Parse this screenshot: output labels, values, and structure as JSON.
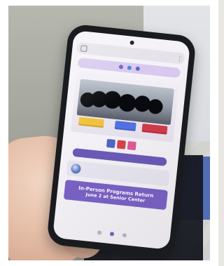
{
  "scene": {
    "device": "smartphone",
    "background_colors": {
      "wall": "#a7a89f",
      "floor_blue": "#4a67b2",
      "jacket": "#1a1d25"
    }
  },
  "phone_screen": {
    "status_left": "",
    "status_right": "",
    "browser": {
      "url_text": "",
      "menu_icon": "kebab-menu-icon"
    },
    "top_icons": [
      "social-circle-icon",
      "social-circle-icon",
      "social-circle-icon"
    ],
    "hero": {
      "podium_colors": [
        "#f1c33d",
        "#4b6be0",
        "#d23b49"
      ]
    },
    "caption": "",
    "follow_text": "",
    "date_pill": "",
    "logo": {
      "text": "",
      "subtext": ""
    },
    "banner": {
      "line1": "In-Person Programs Return",
      "line2": "June 2 at Senior Center"
    }
  }
}
